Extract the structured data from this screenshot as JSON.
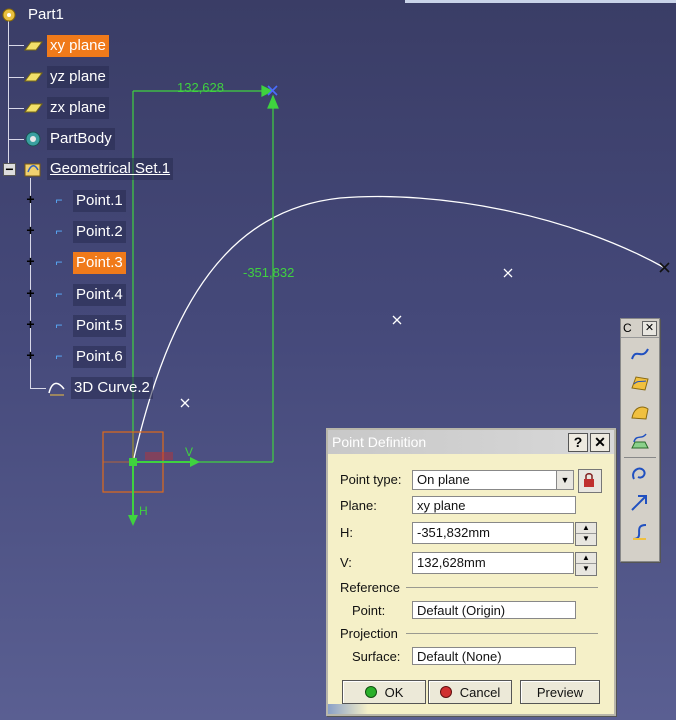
{
  "tree": {
    "root": "Part1",
    "items": [
      {
        "label": "xy plane",
        "selected": true,
        "icon": "plane-icon"
      },
      {
        "label": "yz plane",
        "selected": false,
        "icon": "plane-icon"
      },
      {
        "label": "zx plane",
        "selected": false,
        "icon": "plane-icon"
      },
      {
        "label": "PartBody",
        "selected": false,
        "icon": "gear-body-icon"
      },
      {
        "label": "Geometrical Set.1",
        "selected": false,
        "icon": "geometrical-set-icon"
      }
    ],
    "points": [
      {
        "label": "Point.1",
        "selected": false
      },
      {
        "label": "Point.2",
        "selected": false
      },
      {
        "label": "Point.3",
        "selected": true
      },
      {
        "label": "Point.4",
        "selected": false
      },
      {
        "label": "Point.5",
        "selected": false
      },
      {
        "label": "Point.6",
        "selected": false
      }
    ],
    "curve": "3D Curve.2"
  },
  "viewport": {
    "dim_v": "132,628",
    "dim_h": "-351,832",
    "axis_v": "V",
    "axis_h": "H",
    "colors": {
      "dimension": "#3fd23f",
      "curve": "#ffffff",
      "plane_frame": "#e06a1a"
    }
  },
  "toolbar": {
    "title": "C",
    "close": "✕"
  },
  "dialog": {
    "title": "Point Definition",
    "help": "?",
    "close": "✕",
    "point_type_label": "Point type:",
    "point_type_value": "On plane",
    "plane_label": "Plane:",
    "plane_value": "xy plane",
    "h_label": "H:",
    "h_value": "-351,832mm",
    "v_label": "V:",
    "v_value": "132,628mm",
    "reference_label": "Reference",
    "ref_point_label": "Point:",
    "ref_point_value": "Default (Origin)",
    "projection_label": "Projection",
    "surface_label": "Surface:",
    "surface_value": "Default (None)",
    "ok": "OK",
    "cancel": "Cancel",
    "preview": "Preview"
  }
}
